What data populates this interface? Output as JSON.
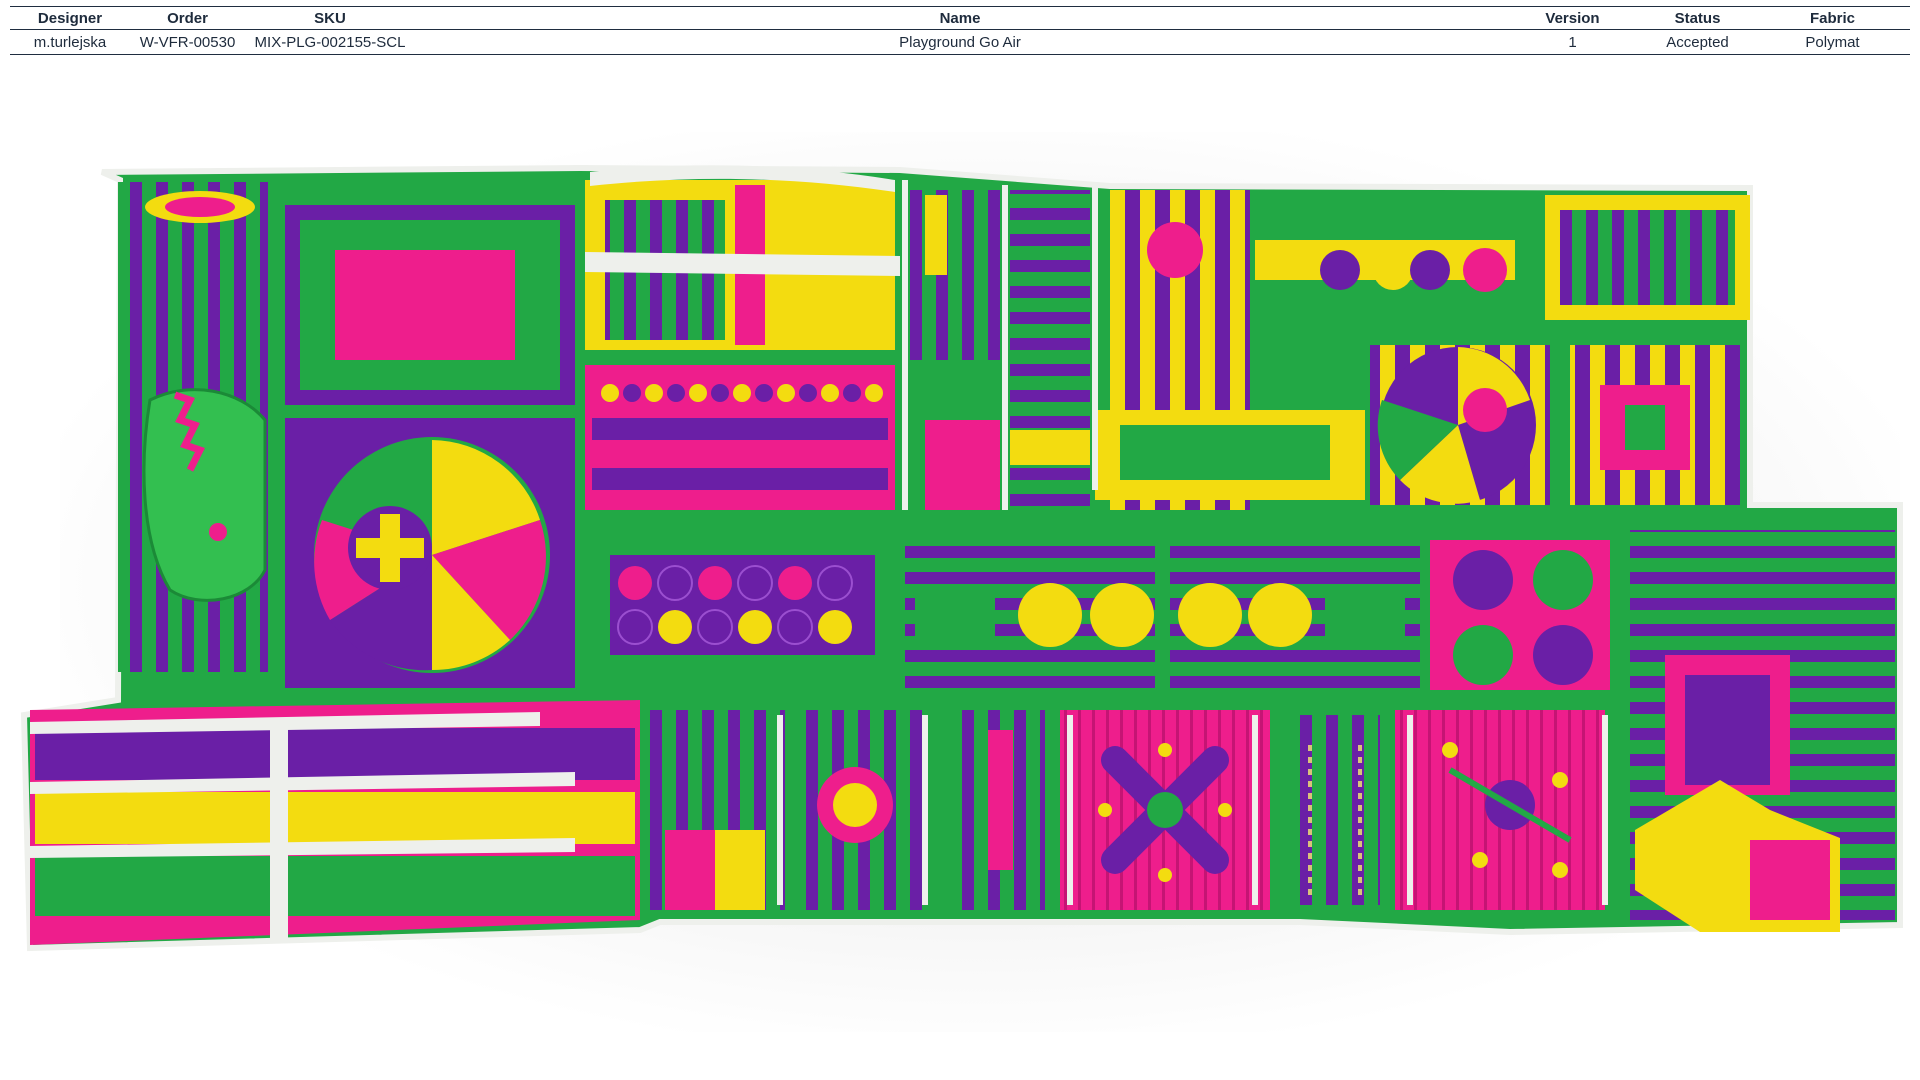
{
  "spec_table": {
    "headers": {
      "designer": "Designer",
      "order": "Order",
      "sku": "SKU",
      "name": "Name",
      "version": "Version",
      "status": "Status",
      "fabric": "Fabric"
    },
    "row": {
      "designer": "m.turlejska",
      "order": "W-VFR-00530",
      "sku": "MIX-PLG-002155-SCL",
      "name": "Playground Go Air",
      "version": "1",
      "status": "Accepted",
      "fabric": "Polymat"
    }
  },
  "colors": {
    "green": "#22a845",
    "purple": "#6a1fa6",
    "pink": "#ee1e8c",
    "yellow": "#f3dc10",
    "white": "#eef0ec",
    "header_text": "#1e2b3c"
  }
}
